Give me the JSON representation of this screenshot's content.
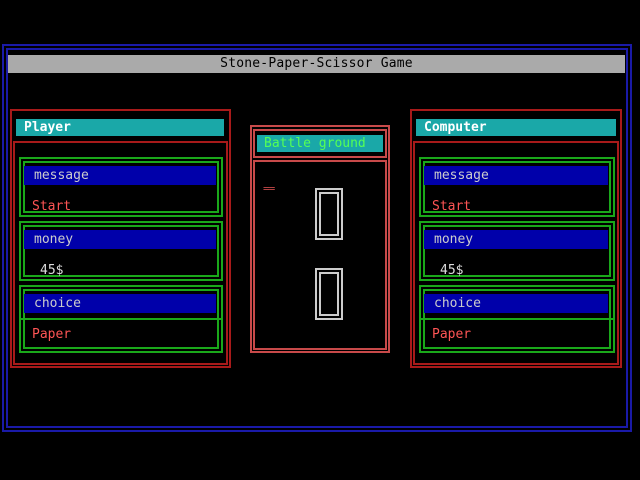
{
  "title": "Stone-Paper-Scissor Game",
  "battle": {
    "header": "Battle ground",
    "marker": "=="
  },
  "player": {
    "name": "Player",
    "message_label": "message",
    "message": "Start",
    "money_label": "money",
    "money": "45$",
    "choice_label": "choice",
    "choice": "Paper"
  },
  "computer": {
    "name": "Computer",
    "message_label": "message",
    "message": "Start",
    "money_label": "money",
    "money": "45$",
    "choice_label": "choice",
    "choice": "Paper"
  },
  "colors": {
    "background": "#000000",
    "window_border": "#1a1aa8",
    "title_bar": "#aaaaaa",
    "panel_border": "#a81a1a",
    "header_bg": "#1aa8a8",
    "section_border": "#1aa81a",
    "label_bg": "#0000aa",
    "value_red": "#ff5555",
    "battle_header_text": "#55ff55"
  }
}
